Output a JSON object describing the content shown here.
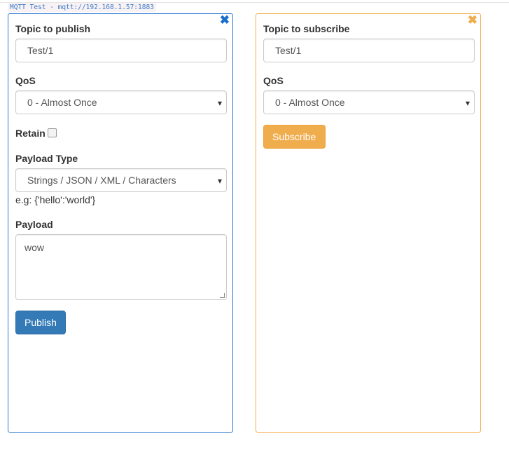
{
  "header": {
    "title": "MQTT Test - mqtt://192.168.1.57:1883"
  },
  "publish": {
    "close_icon": "close-icon",
    "topic_label": "Topic to publish",
    "topic_value": "Test/1",
    "qos_label": "QoS",
    "qos_value": "0 - Almost Once",
    "retain_label": "Retain",
    "retain_checked": false,
    "payload_type_label": "Payload Type",
    "payload_type_value": "Strings / JSON / XML / Characters",
    "payload_hint": "e.g: {'hello':'world'}",
    "payload_label": "Payload",
    "payload_value": "wow",
    "button": "Publish",
    "accent": "#337ab7"
  },
  "subscribe": {
    "close_icon": "close-icon",
    "topic_label": "Topic to subscribe",
    "topic_value": "Test/1",
    "qos_label": "QoS",
    "qos_value": "0 - Almost Once",
    "button": "Subscribe",
    "accent": "#f0ad4e"
  }
}
